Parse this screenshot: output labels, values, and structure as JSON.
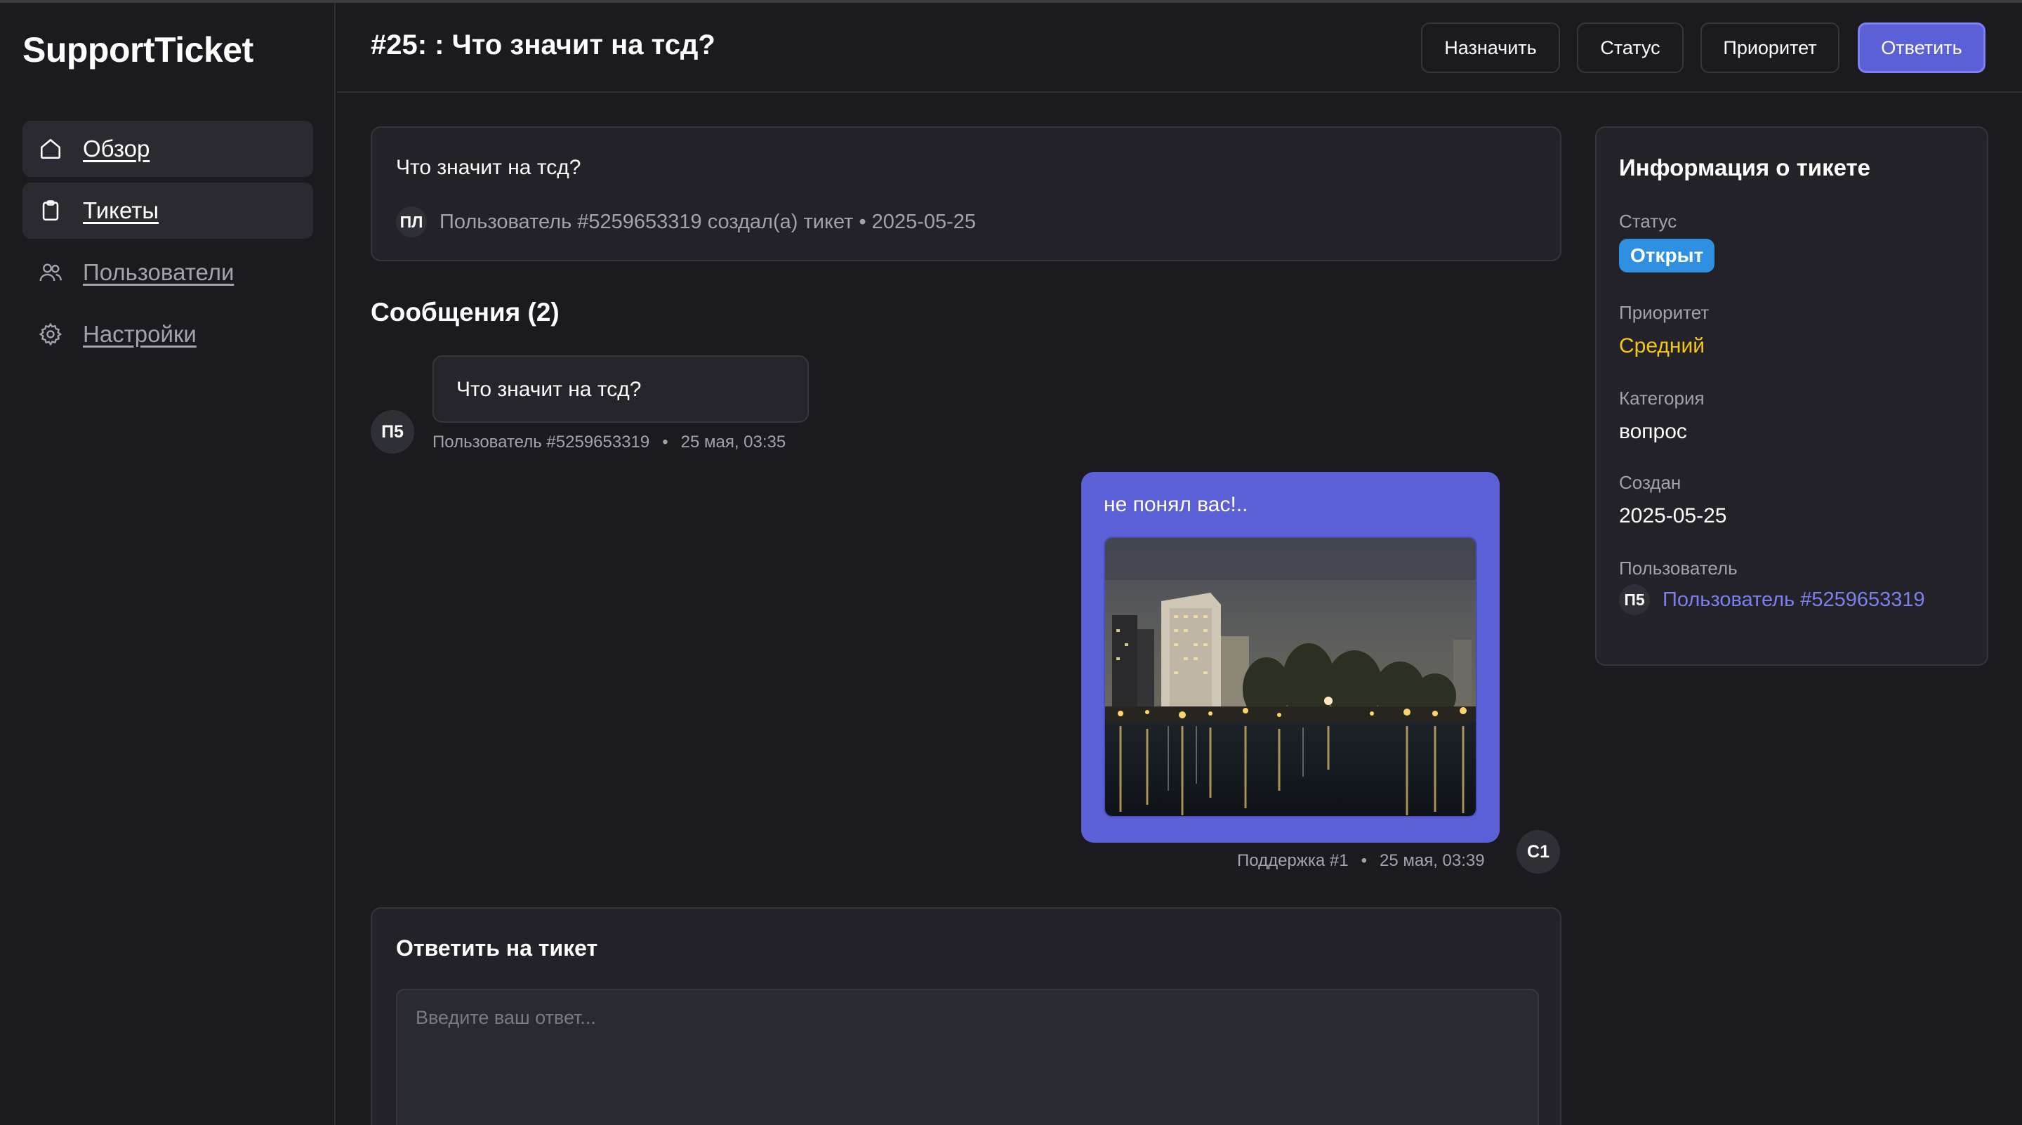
{
  "brand": "SupportTicket",
  "nav": [
    {
      "label": "Обзор",
      "icon": "home-icon"
    },
    {
      "label": "Тикеты",
      "icon": "clipboard-icon"
    },
    {
      "label": "Пользователи",
      "icon": "users-icon"
    },
    {
      "label": "Настройки",
      "icon": "gear-icon"
    }
  ],
  "header": {
    "title": "#25: : Что значит на тсд?",
    "buttons": {
      "assign": "Назначить",
      "status": "Статус",
      "priority": "Приоритет",
      "reply": "Ответить"
    }
  },
  "ticket": {
    "text": "Что значит на тсд?",
    "avatar": "ПЛ",
    "meta": "Пользователь #5259653319 создал(а) тикет • 2025-05-25"
  },
  "messages_title": "Сообщения (2)",
  "messages": [
    {
      "avatar": "П5",
      "text": "Что значит на тсд?",
      "author": "Пользователь #5259653319",
      "separator": "•",
      "time": "25 мая, 03:35"
    },
    {
      "avatar": "С1",
      "text": "не понял вас!..",
      "author": "Поддержка #1",
      "separator": "•",
      "time": "25 мая, 03:39",
      "attachment": "photo-night-river"
    }
  ],
  "reply": {
    "title": "Ответить на тикет",
    "placeholder": "Введите ваш ответ...",
    "value": ""
  },
  "info": {
    "title": "Информация о тикете",
    "status_label": "Статус",
    "status_value": "Открыт",
    "priority_label": "Приоритет",
    "priority_value": "Средний",
    "category_label": "Категория",
    "category_value": "вопрос",
    "created_label": "Создан",
    "created_value": "2025-05-25",
    "user_label": "Пользователь",
    "user_avatar": "П5",
    "user_value": "Пользователь #5259653319"
  },
  "colors": {
    "background": "#1b1b1f",
    "accent": "#5b60d6",
    "status_badge": "#2f8fe0",
    "priority_medium": "#f5c518",
    "link": "#7b80ee"
  }
}
